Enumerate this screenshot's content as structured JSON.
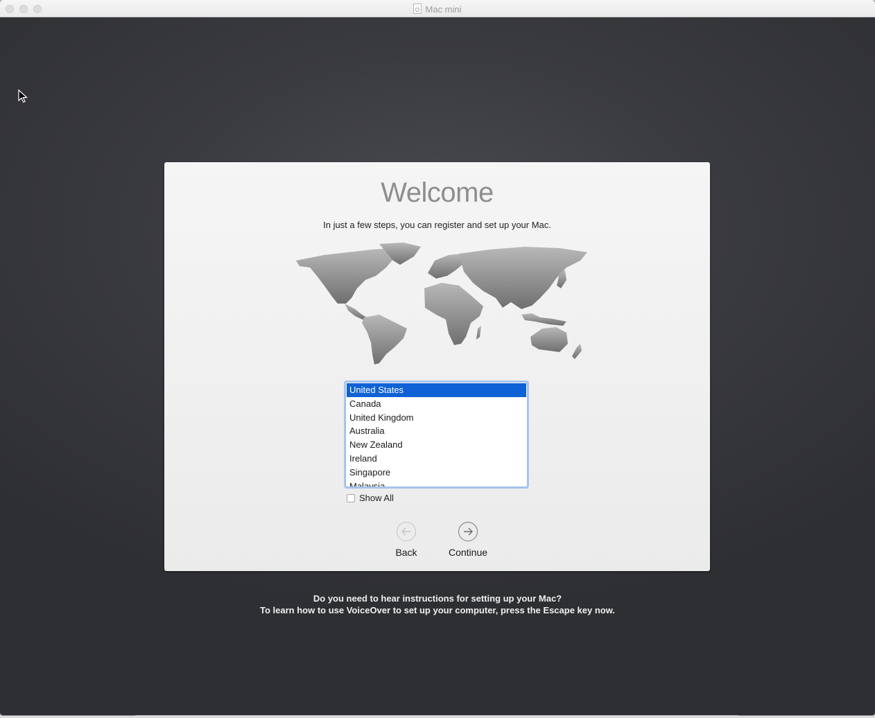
{
  "window": {
    "title": "Mac mini",
    "title_icon": "document-icon"
  },
  "setup": {
    "heading": "Welcome",
    "subtitle": "In just a few steps, you can register and set up your Mac.",
    "map_icon": "world-map",
    "country_list": {
      "selected": "United States",
      "items": [
        "United States",
        "Canada",
        "United Kingdom",
        "Australia",
        "New Zealand",
        "Ireland",
        "Singapore",
        "Malaysia"
      ]
    },
    "show_all": {
      "label": "Show All",
      "checked": false
    },
    "back_button": {
      "label": "Back",
      "icon": "arrow-left-circle-icon",
      "enabled": false
    },
    "continue_button": {
      "label": "Continue",
      "icon": "arrow-right-circle-icon",
      "enabled": true
    }
  },
  "voiceover": {
    "line1": "Do you need to hear instructions for setting up your Mac?",
    "line2": "To learn how to use VoiceOver to set up your computer, press the Escape key now."
  },
  "colors": {
    "selection": "#0f62d6",
    "focus_ring": "#a9c7ef",
    "background": "#3a3b40"
  }
}
